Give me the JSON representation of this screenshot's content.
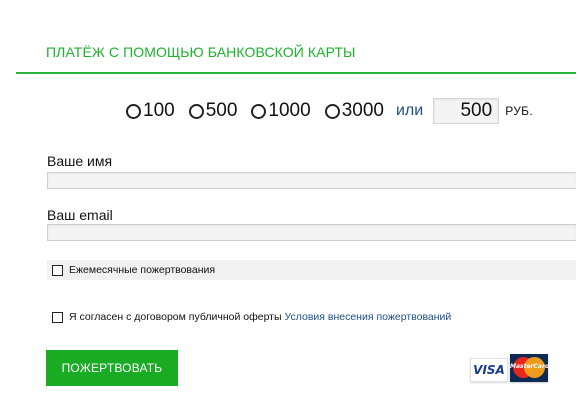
{
  "title": "ПЛАТЁЖ С ПОМОЩЬЮ БАНКОВСКОЙ КАРТЫ",
  "amounts": {
    "options": [
      "100",
      "500",
      "1000",
      "3000"
    ],
    "or_label": "или",
    "custom_value": "500",
    "currency": "РУБ."
  },
  "form": {
    "name_label": "Ваше имя",
    "email_label": "Ваш email",
    "monthly_label": "Ежемесячные пожертвования",
    "agree_label": "Я согласен с договором публичной оферты",
    "terms_link": "Условия внесения пожертвований",
    "donate_button": "ПОЖЕРТВОВАТЬ"
  },
  "payment_logos": {
    "visa": "VISA",
    "mastercard": "MasterCard"
  },
  "colors": {
    "accent_green": "#1aab25",
    "link_blue": "#1f4f8a"
  }
}
